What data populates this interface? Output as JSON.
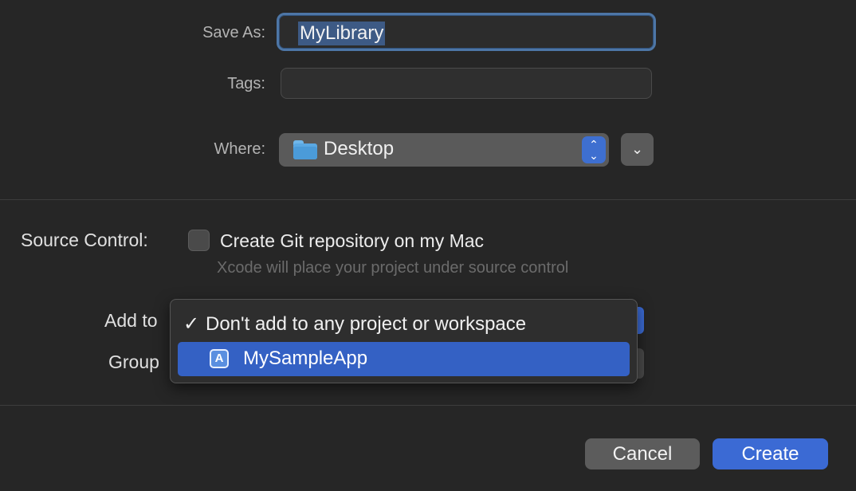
{
  "form": {
    "save_as_label": "Save As:",
    "save_as_value": "MyLibrary",
    "tags_label": "Tags:",
    "tags_value": "",
    "where_label": "Where:",
    "where_value": "Desktop"
  },
  "source_control": {
    "label": "Source Control:",
    "checkbox_label": "Create Git repository on my Mac",
    "checked": false,
    "hint": "Xcode will place your project under source control"
  },
  "add_to": {
    "label": "Add to",
    "group_label": "Group",
    "menu": {
      "items": [
        {
          "label": "Don't add to any project or workspace",
          "checked": true,
          "icon": "checkmark-icon"
        },
        {
          "label": "MySampleApp",
          "highlighted": true,
          "icon": "xcode-app-icon"
        }
      ]
    }
  },
  "buttons": {
    "cancel": "Cancel",
    "create": "Create"
  },
  "colors": {
    "accent": "#3b6ad4",
    "focus_ring": "#4d76a6",
    "background": "#262626"
  }
}
